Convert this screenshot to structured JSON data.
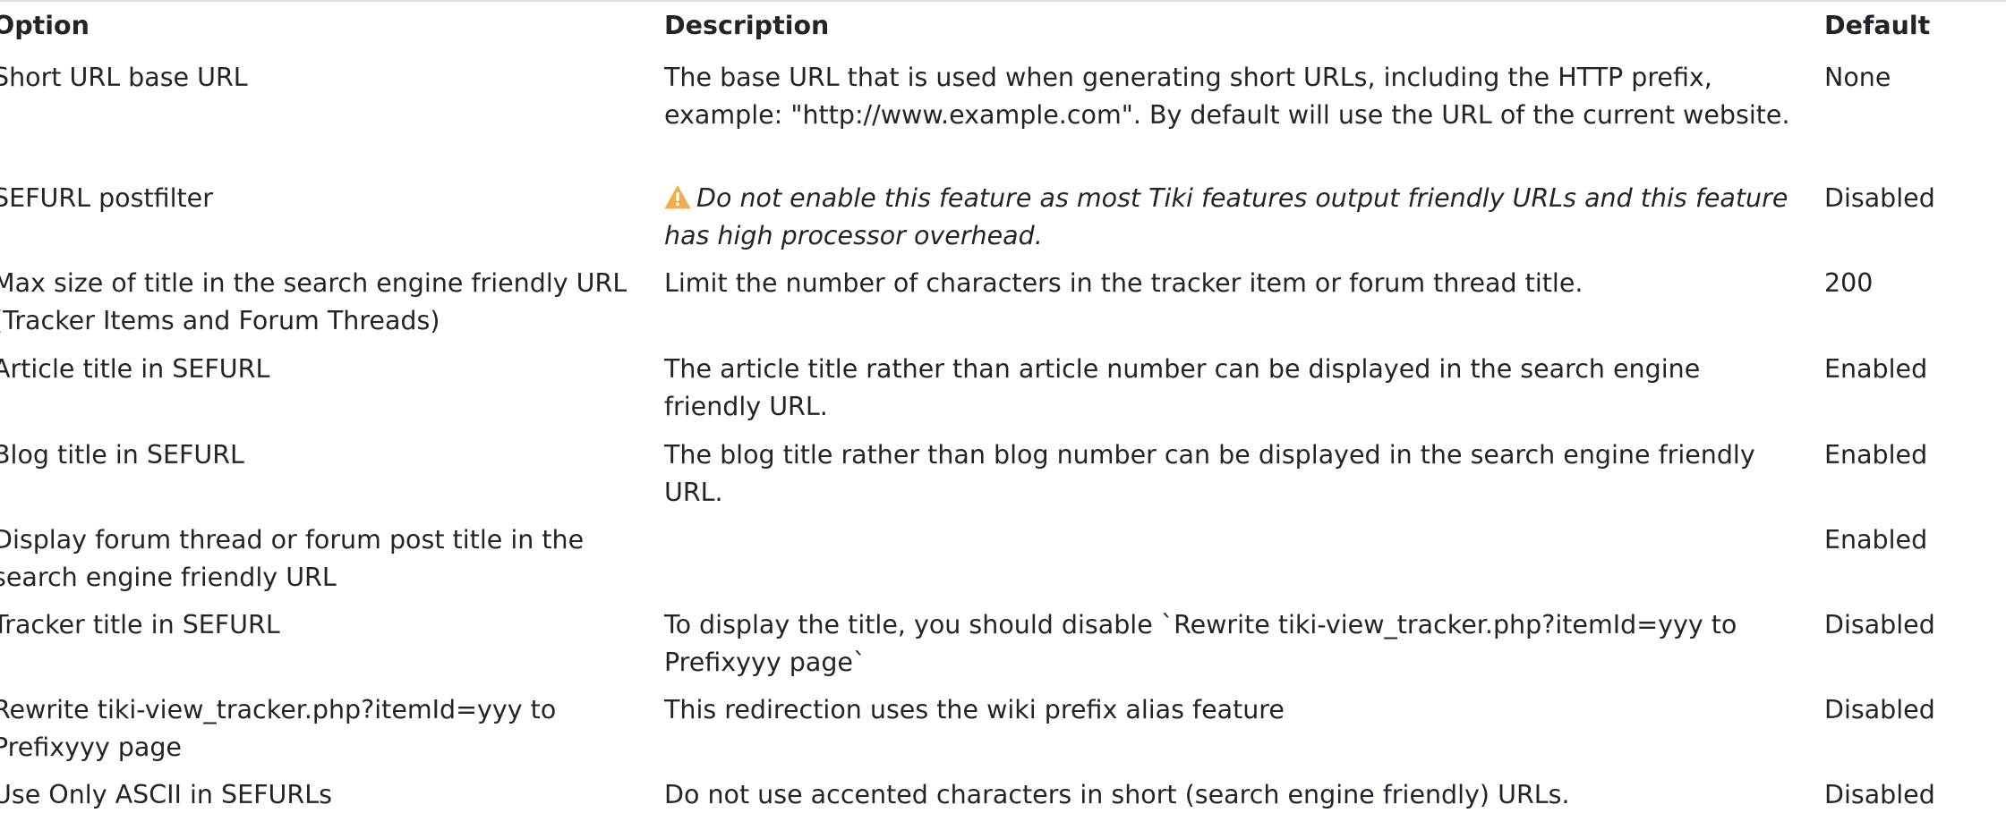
{
  "table": {
    "headers": {
      "option": "Option",
      "description": "Description",
      "default": "Default"
    },
    "rows": [
      {
        "option": "Short URL base URL",
        "description": "The base URL that is used when generating short URLs, including the HTTP prefix, example: \"http://www.example.com\". By default will use the URL of the current website.",
        "default": "None"
      },
      {
        "option": "SEFURL postfilter",
        "description": "Do not enable this feature as most Tiki features output friendly URLs and this feature has high processor overhead.",
        "description_icon": "warning-icon",
        "default": "Disabled"
      },
      {
        "option": "Max size of title in the search engine friendly URL (Tracker Items and Forum Threads)",
        "description": "Limit the number of characters in the tracker item or forum thread title.",
        "default": "200"
      },
      {
        "option": "Article title in SEFURL",
        "description": "The article title rather than article number can be displayed in the search engine friendly URL.",
        "default": "Enabled"
      },
      {
        "option": "Blog title in SEFURL",
        "description": "The blog title rather than blog number can be displayed in the search engine friendly URL.",
        "default": "Enabled"
      },
      {
        "option": "Display forum thread or forum post title in the search engine friendly URL",
        "description": "",
        "default": "Enabled"
      },
      {
        "option": "Tracker title in SEFURL",
        "description": "To display the title, you should disable `Rewrite tiki-view_tracker.php?itemId=yyy to Prefixyyy page`",
        "default": "Disabled"
      },
      {
        "option": "Rewrite tiki-view_tracker.php?itemId=yyy to Prefixyyy page",
        "description": "This redirection uses the wiki prefix alias feature",
        "default": "Disabled"
      },
      {
        "option": "Use Only ASCII in SEFURLs",
        "description": "Do not use accented characters in short (search engine friendly) URLs.",
        "default": "Disabled"
      }
    ]
  },
  "colors": {
    "warning": "#f0ad4e",
    "text": "#212529",
    "rule": "#dee2e6"
  }
}
